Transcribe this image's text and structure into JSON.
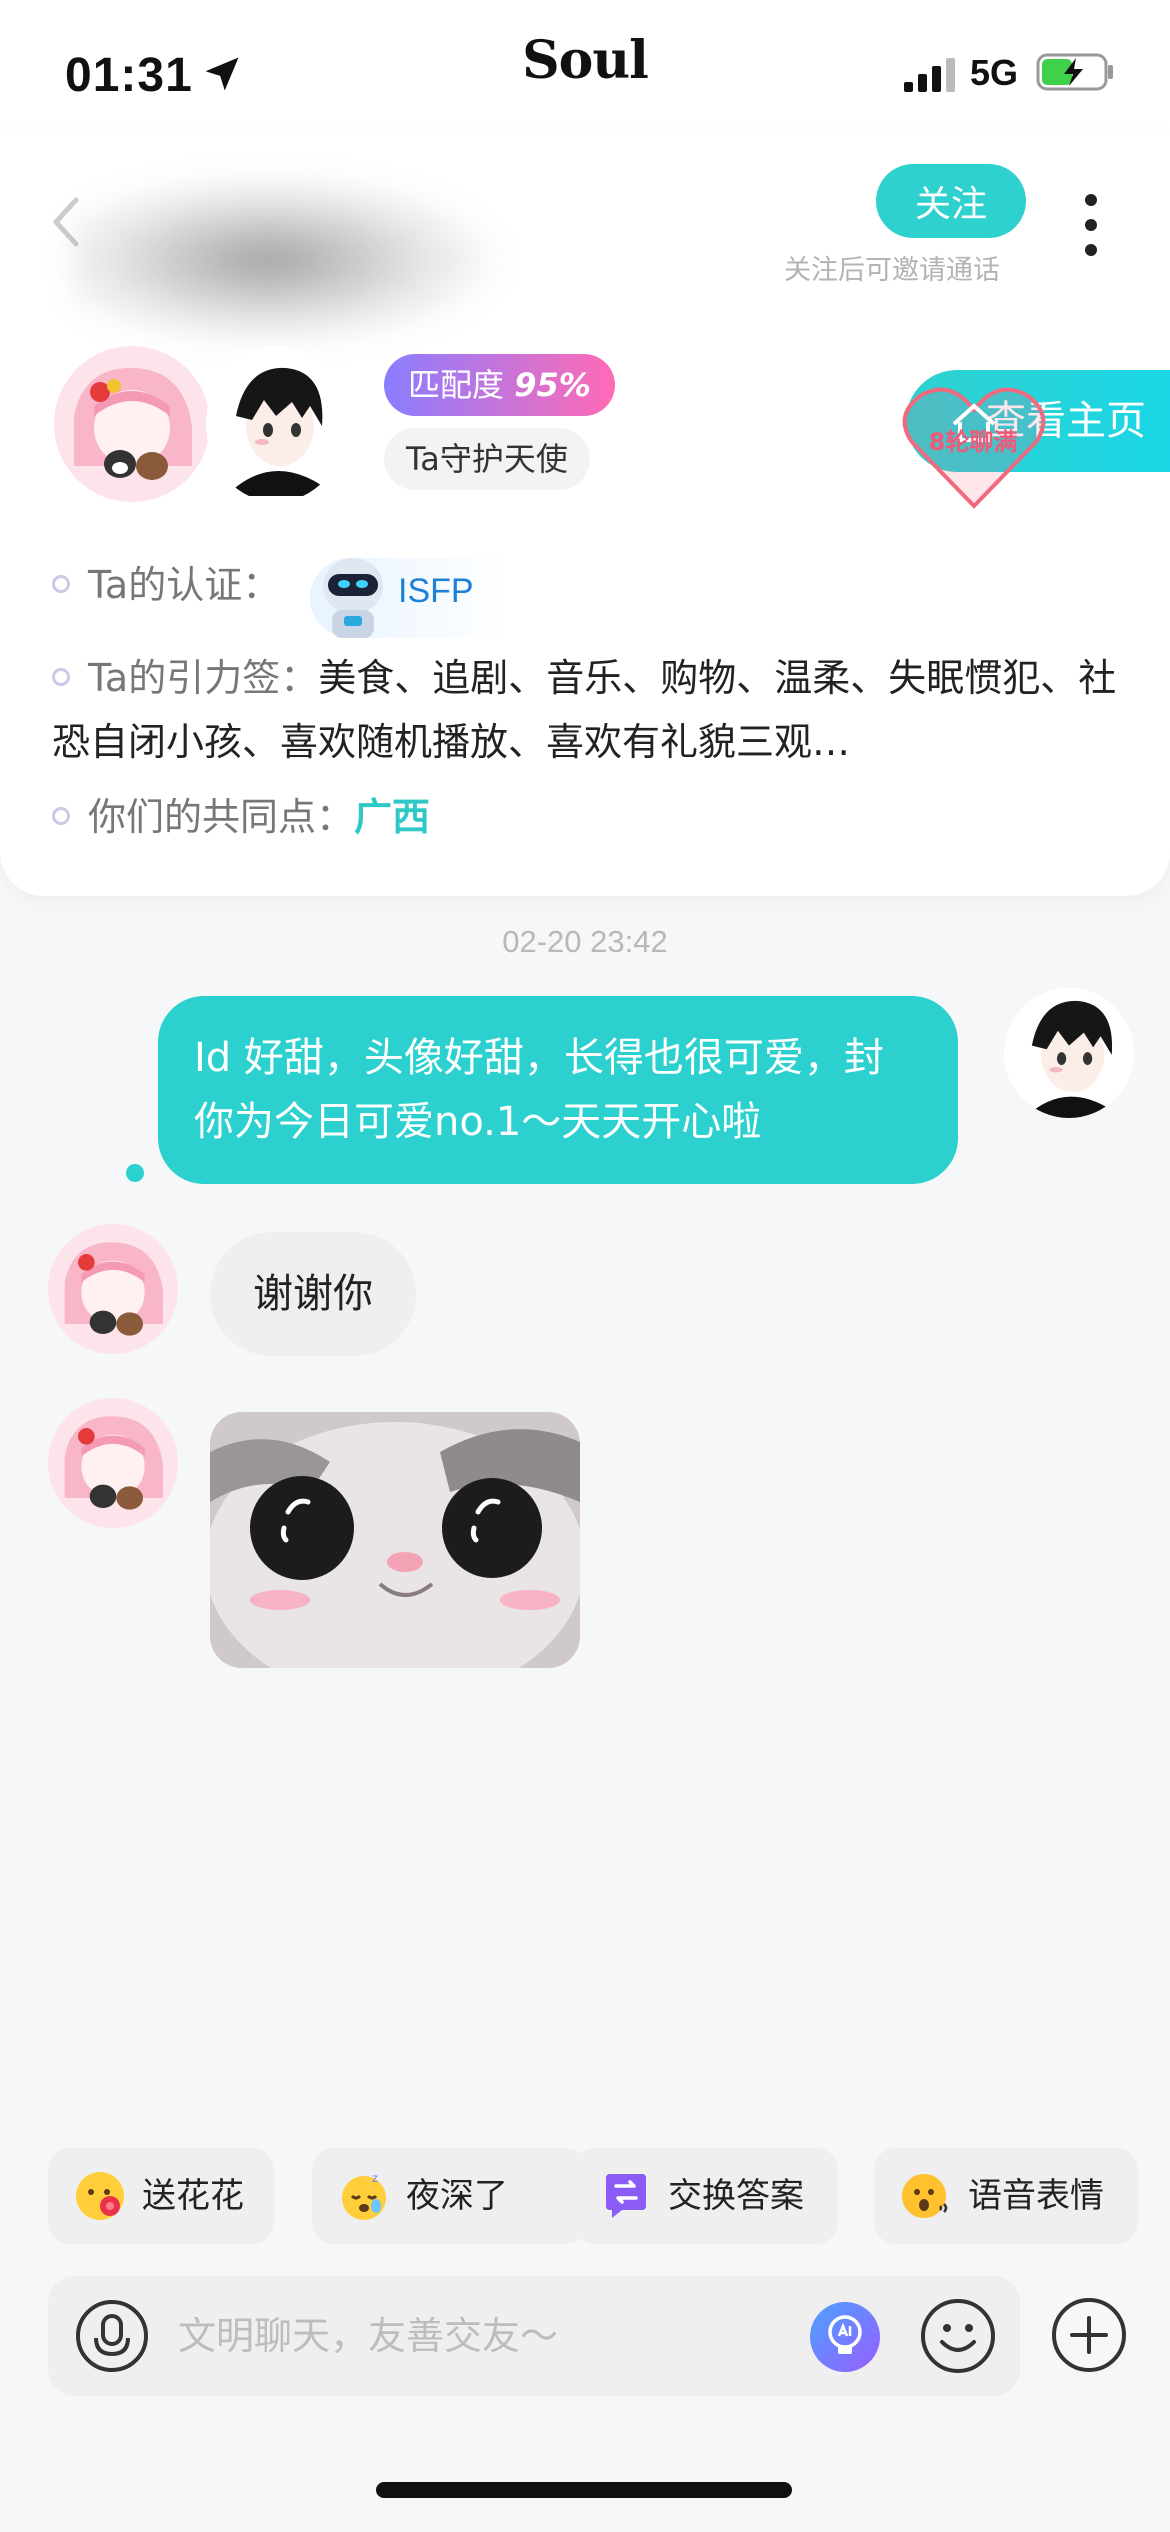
{
  "status_bar": {
    "time": "01:31",
    "network": "5G",
    "app_title": "Soul"
  },
  "header": {
    "follow_label": "关注",
    "follow_hint": "关注后可邀请通话",
    "match_prefix": "匹配度",
    "match_value": "95%",
    "guard_badge": "Ta守护天使",
    "homepage_label": "查看主页",
    "heart_badge": "8轮聊满"
  },
  "profile": {
    "cert_label": "Ta的认证：",
    "mbti": "ISFP",
    "tags_label": "Ta的引力签：",
    "tags_value": "美食、追剧、音乐、购物、温柔、失眠惯犯、社恐自闭小孩、喜欢随机播放、喜欢有礼貌三观…",
    "common_label": "你们的共同点：",
    "common_value": "广西"
  },
  "chat": {
    "timestamp": "02-20 23:42",
    "outgoing_message": "Id 好甜，头像好甜，长得也很可爱，封你为今日可爱no.1～天天开心啦",
    "incoming_message": "谢谢你"
  },
  "quick_replies": [
    {
      "label": "送花花",
      "icon": "flower-emoji-icon"
    },
    {
      "label": "夜深了",
      "icon": "sleepy-emoji-icon"
    },
    {
      "label": "交换答案",
      "icon": "swap-chat-icon"
    },
    {
      "label": "语音表情",
      "icon": "voice-emoji-icon"
    }
  ],
  "input": {
    "placeholder": "文明聊天，友善交友～"
  },
  "colors": {
    "accent": "#2cd1cf",
    "match_start": "#8a7dff",
    "match_end": "#ff6bb5"
  }
}
